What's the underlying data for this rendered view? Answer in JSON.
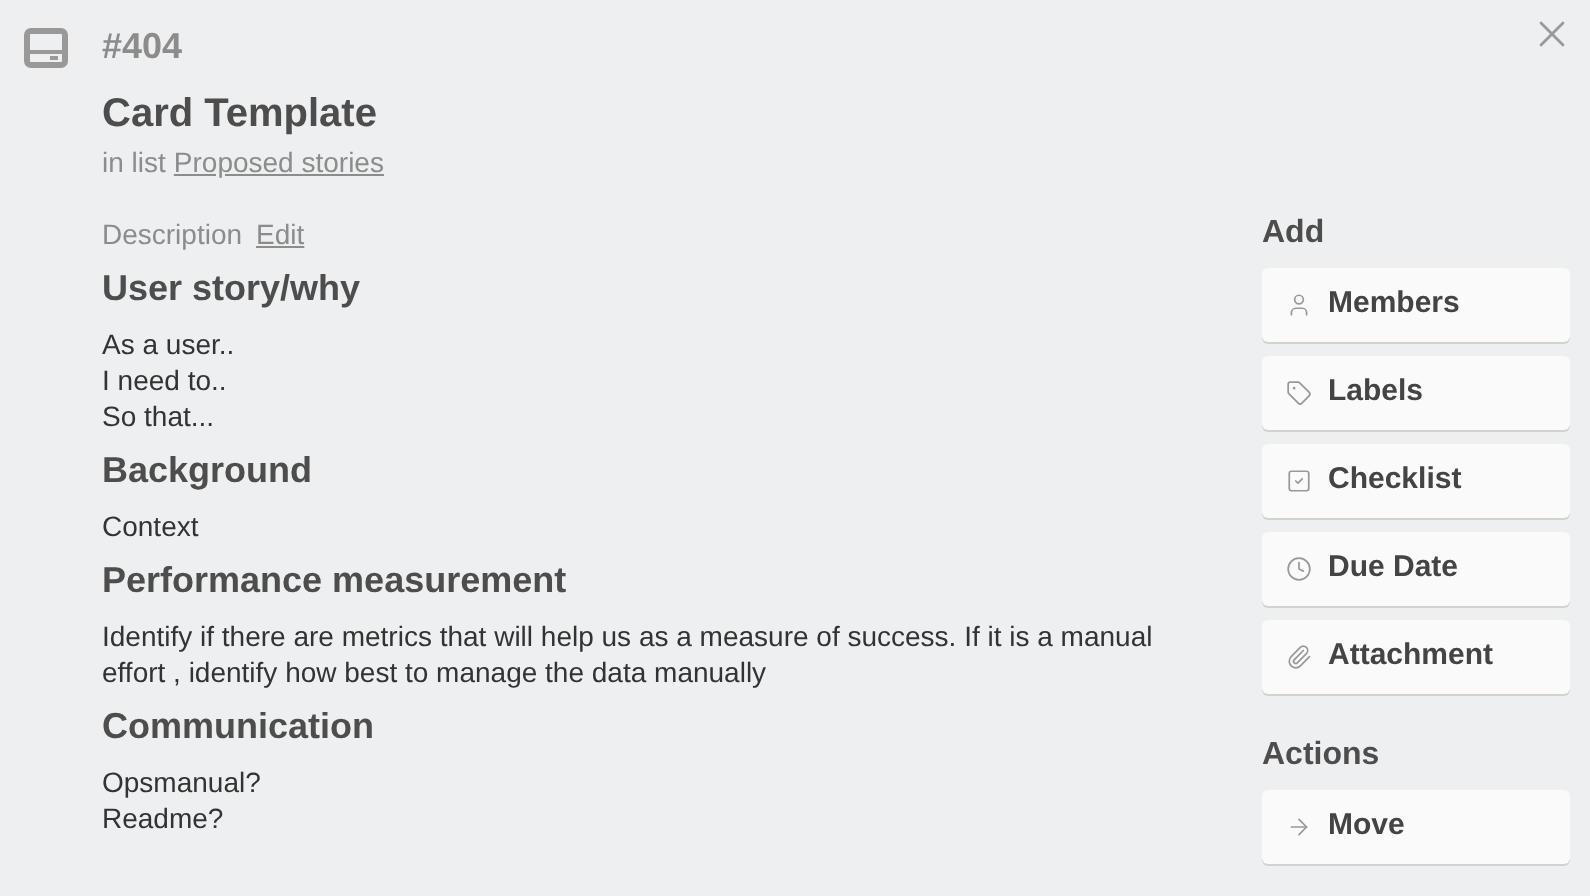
{
  "card": {
    "number": "#404",
    "title": "Card Template",
    "list_prefix": "in list",
    "list_name": "Proposed stories"
  },
  "description": {
    "label": "Description",
    "edit_link": "Edit",
    "sections": [
      {
        "heading": "User story/why",
        "lines": [
          "As a user..",
          "I need to..",
          "So that..."
        ]
      },
      {
        "heading": "Background",
        "lines": [
          "Context"
        ]
      },
      {
        "heading": "Performance measurement",
        "lines": [
          "Identify if there are metrics that will help us as a measure of success. If it is a manual effort , identify how best to manage the data manually"
        ]
      },
      {
        "heading": "Communication",
        "lines": [
          "Opsmanual?",
          "Readme?"
        ]
      }
    ]
  },
  "sidebar": {
    "groups": [
      {
        "title": "Add",
        "buttons": [
          {
            "label": "Members",
            "kind": "person"
          },
          {
            "label": "Labels",
            "kind": "tag"
          },
          {
            "label": "Checklist",
            "kind": "checklist"
          },
          {
            "label": "Due Date",
            "kind": "clock"
          },
          {
            "label": "Attachment",
            "kind": "paperclip"
          }
        ]
      },
      {
        "title": "Actions",
        "buttons": [
          {
            "label": "Move",
            "kind": "arrow"
          }
        ]
      }
    ]
  }
}
